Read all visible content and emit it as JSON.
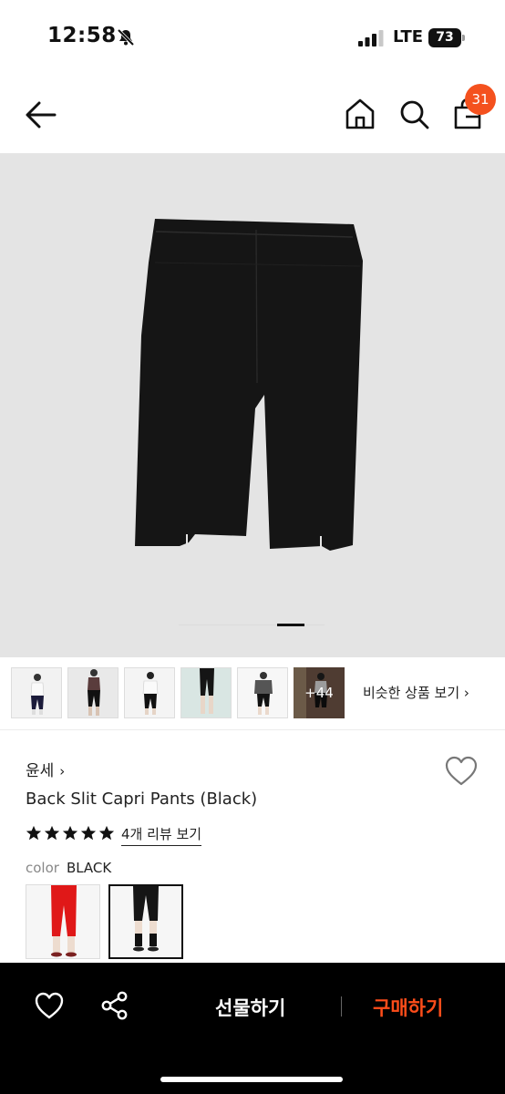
{
  "status_bar": {
    "time": "12:58",
    "network": "LTE",
    "battery": "73"
  },
  "header": {
    "cart_count": "31"
  },
  "thumbnails": {
    "more_label": "+44",
    "similar_label": "비슷한 상품 보기 ›"
  },
  "product": {
    "brand": "윤세",
    "brand_chevron": "›",
    "title": "Back Slit Capri Pants (Black)",
    "rating": 5,
    "review_label": "4개 리뷰 보기",
    "color_key": "color",
    "color_value": "BLACK"
  },
  "bottom_bar": {
    "gift_label": "선물하기",
    "buy_label": "구매하기"
  },
  "icons": [
    "bell-off-icon",
    "signal-icon",
    "battery-icon",
    "back-arrow-icon",
    "home-icon",
    "search-icon",
    "shopping-bag-icon",
    "heart-icon",
    "star-icon",
    "share-icon"
  ],
  "colors": {
    "badge": "#f4511e",
    "buy": "#ff4d1a",
    "image_bg": "#e4e4e4",
    "bottom_bar": "#000000"
  }
}
